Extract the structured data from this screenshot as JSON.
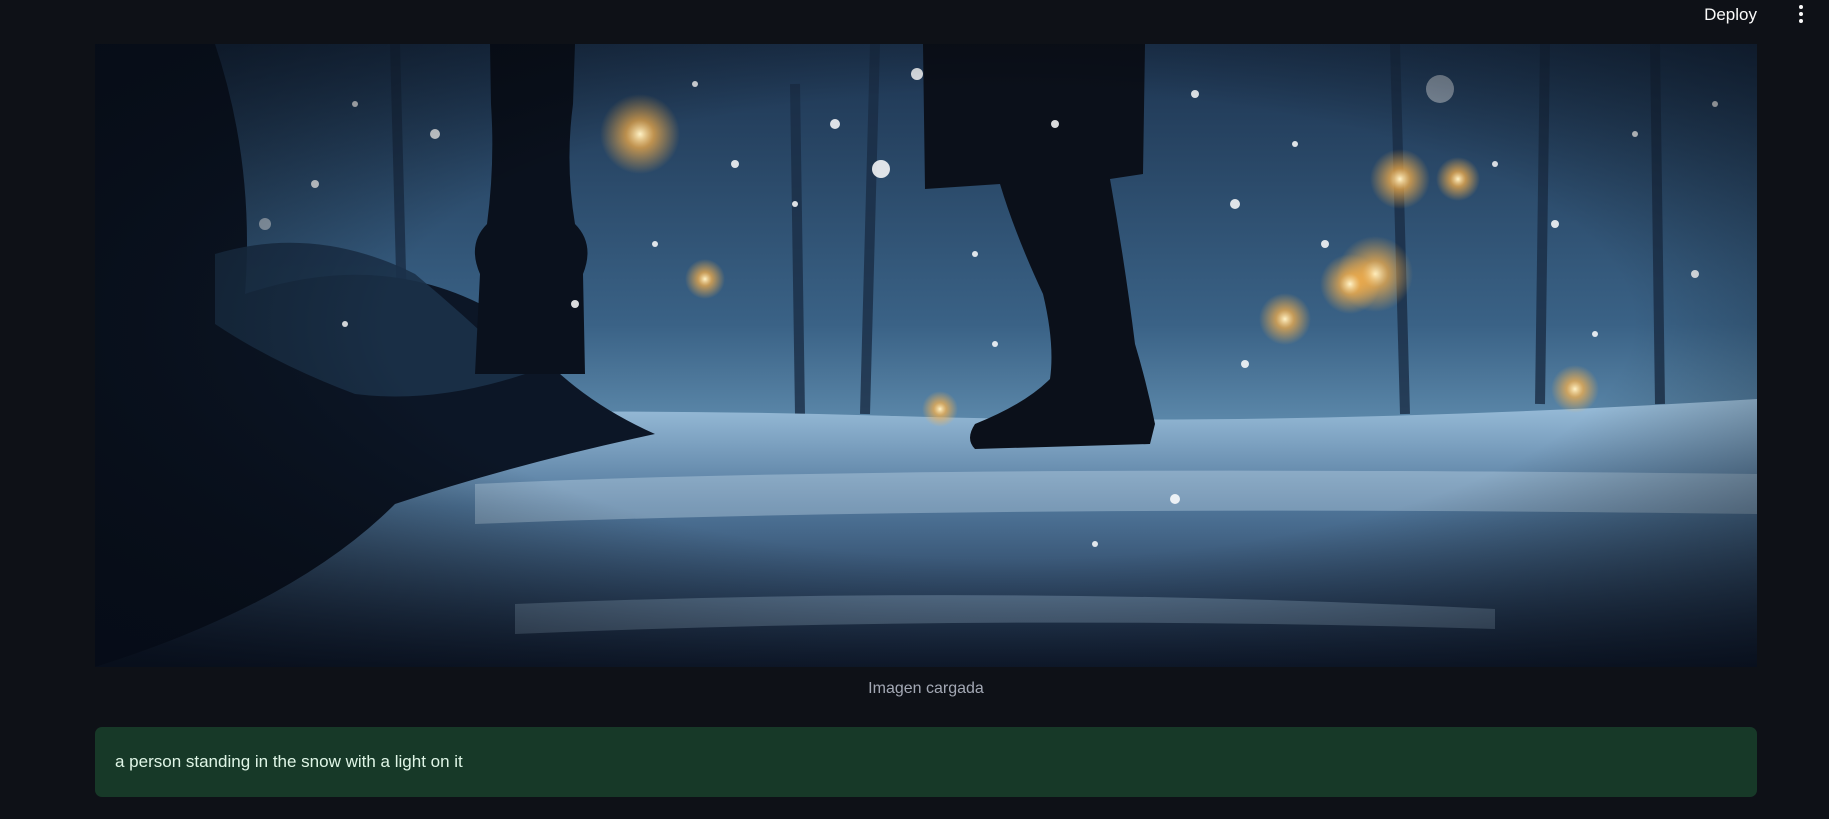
{
  "header": {
    "deploy_label": "Deploy",
    "menu_icon": "vertical-ellipsis-icon"
  },
  "main": {
    "image": {
      "caption": "Imagen cargada"
    },
    "result": {
      "text": "a person standing in the snow with a light on it",
      "status_color": "#173928"
    }
  },
  "colors": {
    "background": "#0e1117",
    "text": "#fafafa",
    "caption": "#a3a8b4"
  }
}
